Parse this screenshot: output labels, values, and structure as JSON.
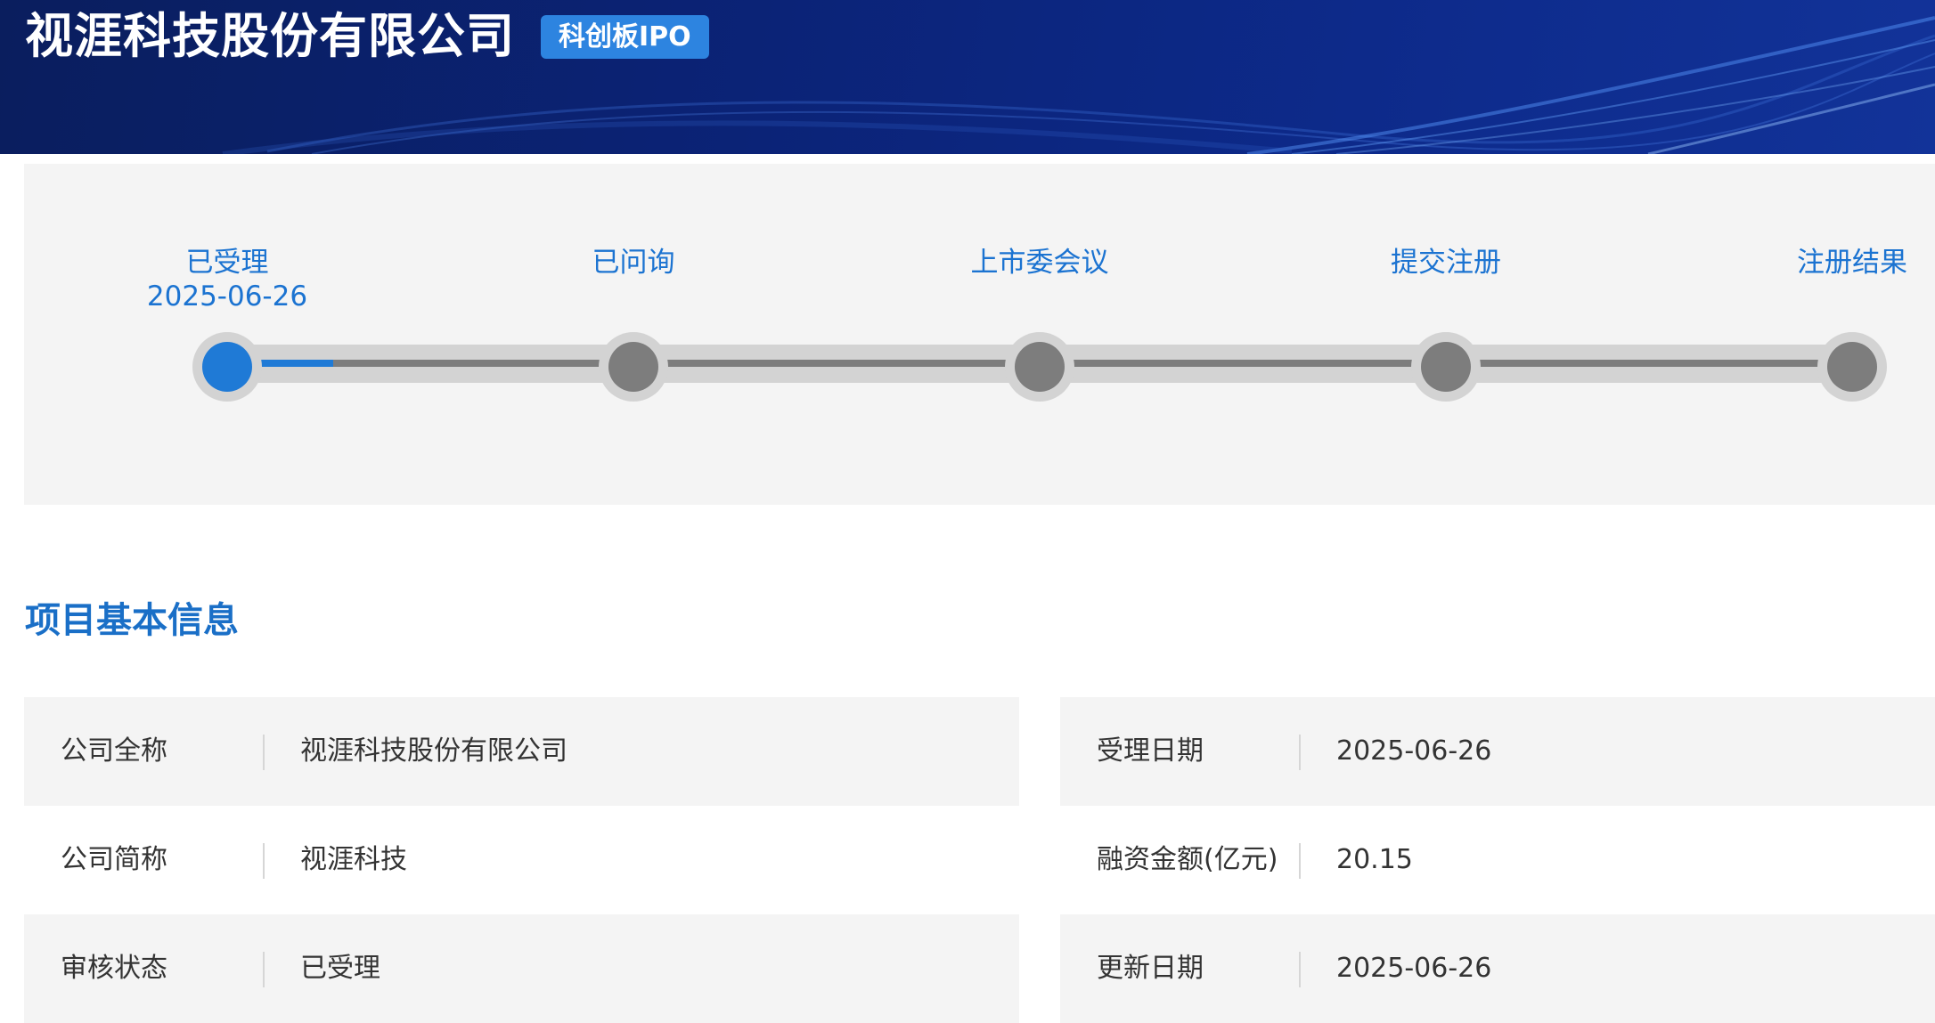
{
  "header": {
    "company_title": "视涯科技股份有限公司",
    "board_badge": "科创板IPO"
  },
  "progress": {
    "steps": [
      {
        "label": "已受理",
        "date": "2025-06-26",
        "status": "completed"
      },
      {
        "label": "已问询",
        "date": "",
        "status": "pending"
      },
      {
        "label": "上市委会议",
        "date": "",
        "status": "pending"
      },
      {
        "label": "提交注册",
        "date": "",
        "status": "pending"
      },
      {
        "label": "注册结果",
        "date": "",
        "status": "pending"
      }
    ],
    "completed_fraction": 0.065,
    "colors": {
      "active": "#1f7ad6",
      "inactive": "#7d7d7d",
      "track": "#d3d3d3"
    }
  },
  "basic_info": {
    "title": "项目基本信息",
    "left": [
      {
        "label": "公司全称",
        "value": "视涯科技股份有限公司"
      },
      {
        "label": "公司简称",
        "value": "视涯科技"
      },
      {
        "label": "审核状态",
        "value": "已受理"
      }
    ],
    "right": [
      {
        "label": "受理日期",
        "value": "2025-06-26"
      },
      {
        "label": "融资金额(亿元)",
        "value": "20.15"
      },
      {
        "label": "更新日期",
        "value": "2025-06-26"
      }
    ]
  }
}
